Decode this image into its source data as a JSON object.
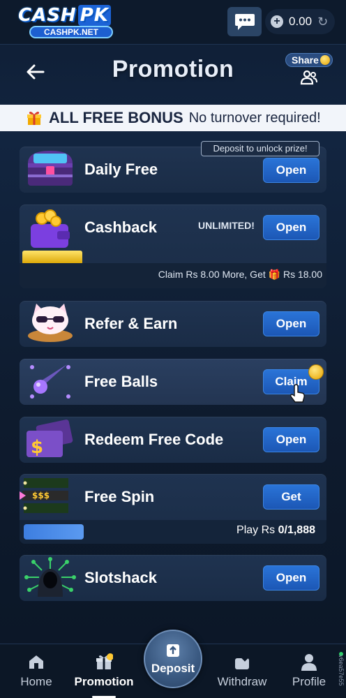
{
  "topbar": {
    "logo_main": "CASH",
    "logo_pk": "PK",
    "logo_sub": "CASHPK.NET",
    "balance": "0.00",
    "icons": {
      "chat": "chat-bubble-icon",
      "plus": "plus-circle-icon",
      "refresh": "refresh-icon"
    }
  },
  "header": {
    "title": "Promotion",
    "share_label": "Share",
    "icons": {
      "back": "arrow-left-icon",
      "share_people": "people-icon",
      "coin": "coin-icon"
    }
  },
  "banner": {
    "bold": "ALL FREE BONUS",
    "light": "No turnover required!",
    "icon": "gift-icon"
  },
  "promos": [
    {
      "name": "Daily Free",
      "button": "Open",
      "tag": "Deposit to unlock prize!",
      "icon": "treasure-chest-icon"
    },
    {
      "name": "Cashback",
      "button": "Open",
      "badge": "UNLIMITED!",
      "progress_text": "Claim Rs 8.00 More, Get 🎁 Rs 18.00",
      "icon": "wallet-coins-icon"
    },
    {
      "name": "Refer & Earn",
      "button": "Open",
      "icon": "cat-mascot-icon"
    },
    {
      "name": "Free Balls",
      "button": "Claim",
      "icon": "ball-icon"
    },
    {
      "name": "Redeem Free Code",
      "button": "Open",
      "icon": "tickets-icon"
    },
    {
      "name": "Free Spin",
      "button": "Get",
      "slot_text": "$$$",
      "play_label": "Play Rs",
      "play_value": "0/1,888",
      "icon": "slot-icon"
    },
    {
      "name": "Slotshack",
      "button": "Open",
      "icon": "hacker-icon"
    }
  ],
  "nav": {
    "home": "Home",
    "promotion": "Promotion",
    "deposit": "Deposit",
    "withdraw": "Withdraw",
    "profile": "Profile",
    "active": "Promotion"
  },
  "side_code": "v6ea57e55",
  "colors": {
    "accent": "#1c57b5",
    "background": "#0f1d33",
    "banner": "#f2f5fa",
    "gold": "#ffd23a"
  }
}
